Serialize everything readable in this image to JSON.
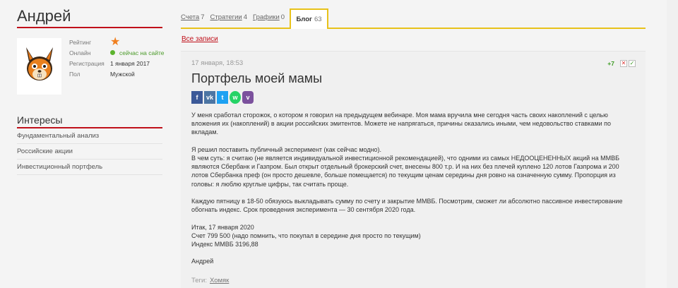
{
  "profile": {
    "name": "Андрей",
    "fields": [
      {
        "label": "Рейтинг",
        "value": ""
      },
      {
        "label": "Онлайн",
        "value": "сейчас на сайте"
      },
      {
        "label": "Регистрация",
        "value": "1 января 2017"
      },
      {
        "label": "Пол",
        "value": "Мужской"
      }
    ]
  },
  "interests": {
    "title": "Интересы",
    "items": [
      "Фундаментальный анализ",
      "Российские акции",
      "Инвестиционный портфель"
    ]
  },
  "tabs": [
    {
      "label": "Счета",
      "count": "7"
    },
    {
      "label": "Стратегии",
      "count": "4"
    },
    {
      "label": "Графики",
      "count": "0"
    },
    {
      "label": "Блог",
      "count": "63",
      "active": true
    }
  ],
  "all_posts_link": "Все записи",
  "post": {
    "date": "17 января, 18:53",
    "votes": "+7",
    "title": "Портфель моей мамы",
    "share": [
      {
        "icon": "facebook-icon",
        "glyph": "f"
      },
      {
        "icon": "vk-icon",
        "glyph": "vk"
      },
      {
        "icon": "twitter-icon",
        "glyph": "t"
      },
      {
        "icon": "whatsapp-icon",
        "glyph": "w"
      },
      {
        "icon": "viber-icon",
        "glyph": "v"
      }
    ],
    "paragraphs": [
      [
        "У меня сработал сторожок, о котором я говорил на предыдущем вебинаре. Моя мама вручила мне сегодня часть своих накоплений с целью вложения их (накоплений) в акции российских эмитентов. Можете не напрягаться, причины оказались иными, чем недовольство ставками по вкладам."
      ],
      [
        "Я решил поставить публичный эксперимент (как сейчас модно).",
        "В чем суть: я считаю (не является индивидуальной инвестиционной рекомендацией), что одними из самых НЕДООЦЕНЕННЫХ акций на ММВБ являются Сбербанк и Газпром. Был открыт отдельный брокерский счет, внесены 800 т.р. И на них без плечей куплено 120 лотов Газпрома и 200 лотов Сбербанка преф (он просто дешевле, больше помещается) по текущим ценам середины дня ровно на означенную сумму. Пропорция из головы: я люблю круглые цифры, так считать проще."
      ],
      [
        "Каждую пятницу в 18-50 обязуюсь выкладывать сумму по счету и закрытие ММВБ. Посмотрим, сможет ли абсолютно пассивное инвестирование обогнать индекс. Срок проведения эксперимента — 30 сентября 2020 года."
      ],
      [
        "Итак, 17 января 2020",
        "Счет 799 500 (надо помнить, что покупал в середине дня просто по текущим)",
        "Индекс ММВБ 3196,88"
      ],
      [
        "Андрей"
      ]
    ],
    "tags_label": "Теги:",
    "tags": [
      "Хомяк"
    ]
  },
  "colors": {
    "accent_red": "#c0101a",
    "tab_yellow": "#e8c21a",
    "online_green": "#5cb32e",
    "star_orange": "#f07f1f"
  }
}
